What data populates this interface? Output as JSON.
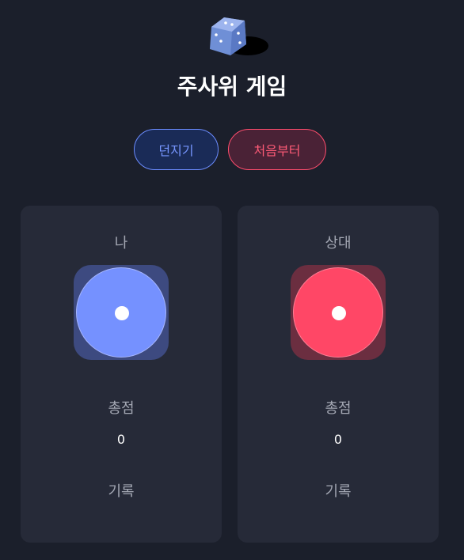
{
  "header": {
    "logo_icon": "dice-icon",
    "title": "주사위 게임"
  },
  "controls": {
    "roll_label": "던지기",
    "reset_label": "처음부터"
  },
  "players": [
    {
      "name": "나",
      "die_value": 1,
      "total_label": "총점",
      "total": "0",
      "history_label": "기록",
      "color": "#7591ff"
    },
    {
      "name": "상대",
      "die_value": 1,
      "total_label": "총점",
      "total": "0",
      "history_label": "기록",
      "color": "#ff4766"
    }
  ],
  "colors": {
    "background": "#1b1f2b",
    "card": "#262a38",
    "accent_blue": "#6b8cff",
    "accent_red": "#ff4d6d"
  }
}
